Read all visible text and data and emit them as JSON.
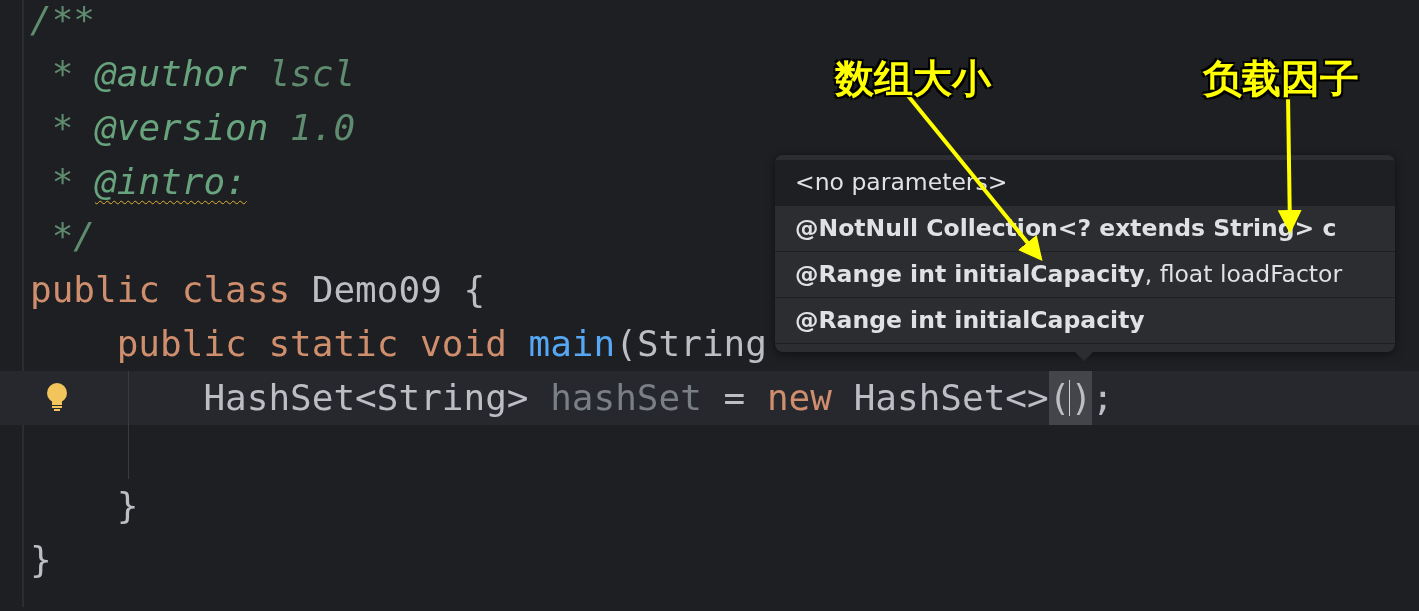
{
  "editor": {
    "lines": [
      {
        "kind": "code",
        "tokens": [
          {
            "text": "/**",
            "kind": "comment"
          }
        ]
      },
      {
        "kind": "code",
        "tokens": [
          {
            "text": " * ",
            "kind": "comment"
          },
          {
            "text": "@author",
            "kind": "doc-tag",
            "warning": false
          },
          {
            "text": " lscl",
            "kind": "comment"
          }
        ]
      },
      {
        "kind": "code",
        "tokens": [
          {
            "text": " * ",
            "kind": "comment"
          },
          {
            "text": "@version",
            "kind": "doc-tag",
            "warning": false
          },
          {
            "text": " 1.0",
            "kind": "comment"
          }
        ]
      },
      {
        "kind": "code",
        "tokens": [
          {
            "text": " * ",
            "kind": "comment"
          },
          {
            "text": "@intro:",
            "kind": "doc-tag",
            "warning": true
          }
        ]
      },
      {
        "kind": "code",
        "tokens": [
          {
            "text": " */",
            "kind": "comment"
          }
        ]
      },
      {
        "kind": "code",
        "tokens": [
          {
            "text": "public class",
            "kind": "keyword"
          },
          {
            "text": " Demo09 {",
            "kind": "plain"
          }
        ],
        "children": [
          {
            "kind": "code",
            "tokens": [
              {
                "text": "public static void ",
                "kind": "keyword"
              },
              {
                "text": "main",
                "kind": "method"
              },
              {
                "text": "(String",
                "kind": "plain"
              }
            ],
            "children": [
              {
                "kind": "code",
                "current": true,
                "intention": true,
                "tokens": [
                  {
                    "text": "HashSet<String>",
                    "kind": "plain"
                  },
                  {
                    "text": " hashSet",
                    "kind": "unused"
                  },
                  {
                    "text": " = ",
                    "kind": "plain"
                  },
                  {
                    "text": "new",
                    "kind": "keyword"
                  },
                  {
                    "text": " HashSet<>",
                    "kind": "plain"
                  },
                  {
                    "text": "(",
                    "kind": "brace-match"
                  },
                  {
                    "kind": "caret"
                  },
                  {
                    "text": ")",
                    "kind": "brace-match"
                  },
                  {
                    "text": ";",
                    "kind": "plain"
                  }
                ]
              },
              {
                "kind": "blank"
              }
            ]
          },
          {
            "kind": "code",
            "tokens": [
              {
                "text": "}",
                "kind": "plain"
              }
            ]
          }
        ]
      },
      {
        "kind": "code",
        "tokens": [
          {
            "text": "}",
            "kind": "plain"
          }
        ]
      }
    ]
  },
  "parameter_popup": {
    "rows": [
      {
        "text": "<no parameters>",
        "bold": false,
        "selected": true
      },
      {
        "text": "@NotNull Collection<? extends String> c",
        "bold": true,
        "selected": false
      },
      {
        "text": "**@Range int initialCapacity**, float loadFactor",
        "bold": false,
        "selected": false
      },
      {
        "text": "@Range int initialCapacity",
        "bold": true,
        "selected": false
      }
    ]
  },
  "annotations": [
    {
      "text": "数组大小"
    },
    {
      "text": "负载因子"
    }
  ]
}
